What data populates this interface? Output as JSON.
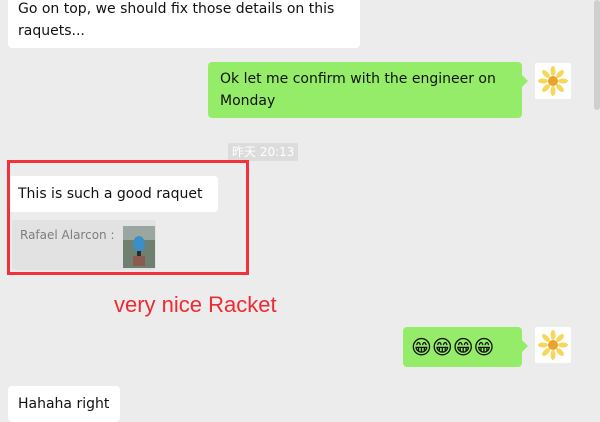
{
  "messages": [
    {
      "direction": "incoming",
      "text": "Go on top, we should fix those details on this raquets..."
    },
    {
      "direction": "outgoing",
      "text": "Ok let me confirm with the engineer on Monday"
    },
    {
      "direction": "timestamp",
      "text": "昨天 20:13"
    },
    {
      "direction": "incoming",
      "text": "This is such a good raquet"
    },
    {
      "direction": "incoming-quote",
      "text": "Rafael Alarcon :"
    },
    {
      "direction": "outgoing",
      "text": "😁😁😁😁"
    },
    {
      "direction": "incoming",
      "text": "Hahaha right"
    }
  ],
  "annotation": {
    "text": "very nice Racket",
    "color": "#ee2a33"
  },
  "colors": {
    "outgoing_bubble": "#95ec69",
    "incoming_bubble": "#ffffff",
    "highlight": "#f2323a"
  },
  "icons": {
    "user_avatar": "sun-flower-icon",
    "quote_thumbnail": "racket-photo-thumbnail"
  }
}
